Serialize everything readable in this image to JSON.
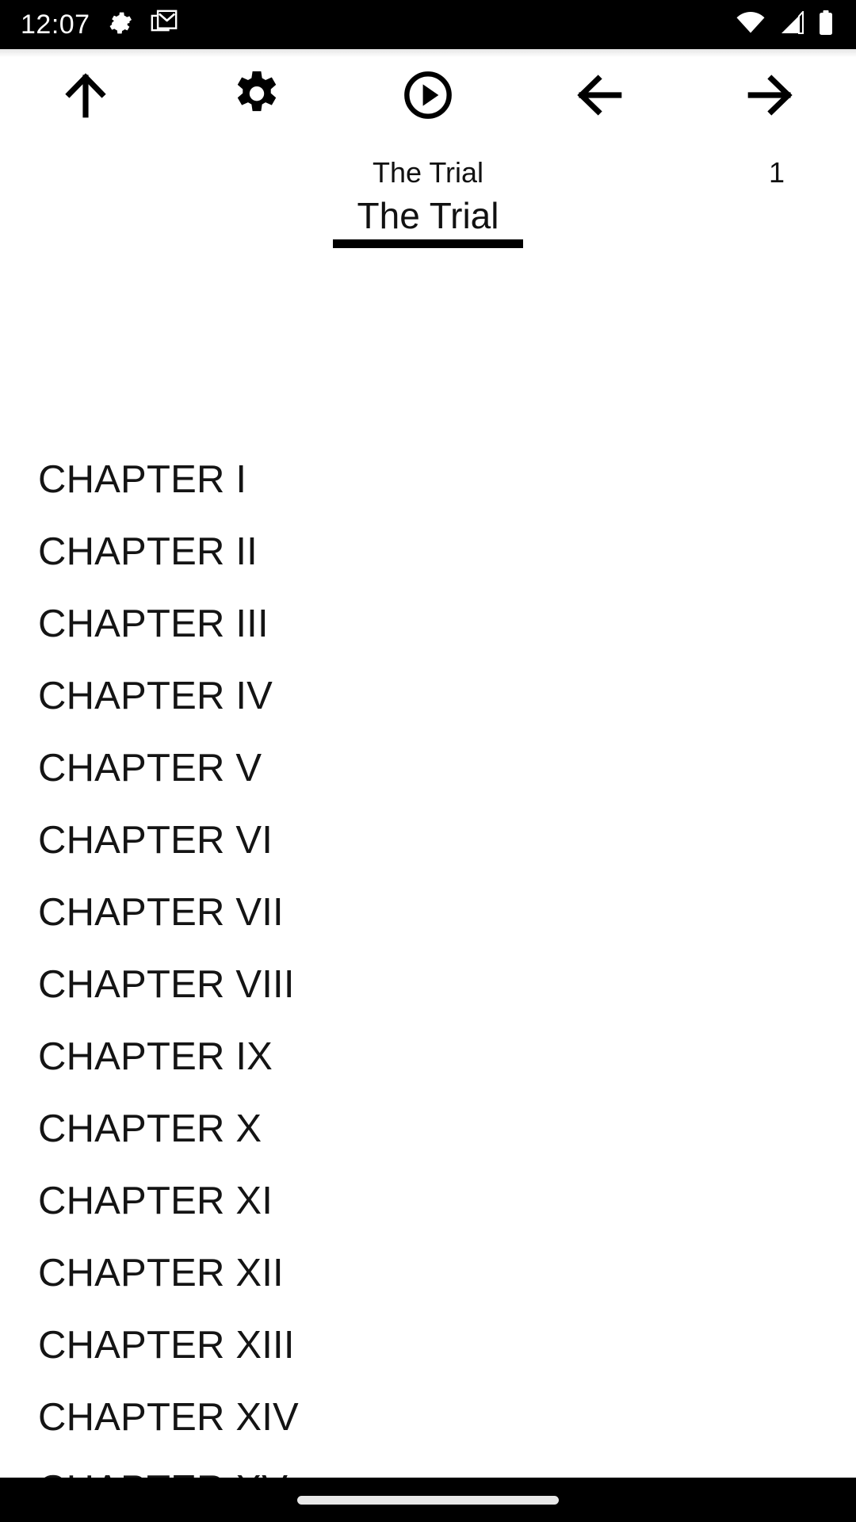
{
  "statusbar": {
    "clock": "12:07",
    "left_icons": [
      {
        "name": "settings-icon",
        "label": "settings"
      },
      {
        "name": "gmail-icon",
        "label": "gmail"
      }
    ],
    "right_icons": [
      {
        "name": "wifi-icon",
        "label": "wifi"
      },
      {
        "name": "cellular-signal-icon",
        "label": "signal"
      },
      {
        "name": "battery-icon",
        "label": "battery"
      }
    ],
    "background": "#000000",
    "foreground": "#ffffff"
  },
  "toolbar": {
    "buttons": [
      {
        "name": "go-up-button",
        "icon": "arrow-up-icon",
        "label": "Up"
      },
      {
        "name": "settings-button",
        "icon": "gear-icon",
        "label": "Settings"
      },
      {
        "name": "play-button",
        "icon": "play-circle-icon",
        "label": "Play"
      },
      {
        "name": "previous-button",
        "icon": "arrow-left-icon",
        "label": "Previous"
      },
      {
        "name": "next-button",
        "icon": "arrow-right-icon",
        "label": "Next"
      }
    ]
  },
  "header": {
    "book_title": "The Trial",
    "page_number": "1"
  },
  "tabs": {
    "selected_index": 0,
    "items": [
      {
        "label": "The Trial"
      }
    ],
    "indicator_color": "#000000"
  },
  "chapters": {
    "items": [
      {
        "label": "CHAPTER I"
      },
      {
        "label": "CHAPTER II"
      },
      {
        "label": "CHAPTER III"
      },
      {
        "label": "CHAPTER IV"
      },
      {
        "label": "CHAPTER V"
      },
      {
        "label": "CHAPTER VI"
      },
      {
        "label": "CHAPTER VII"
      },
      {
        "label": "CHAPTER VIII"
      },
      {
        "label": "CHAPTER IX"
      },
      {
        "label": "CHAPTER X"
      },
      {
        "label": "CHAPTER XI"
      },
      {
        "label": "CHAPTER XII"
      },
      {
        "label": "CHAPTER XIII"
      },
      {
        "label": "CHAPTER XIV"
      },
      {
        "label": "CHAPTER XV"
      }
    ]
  },
  "navbar": {
    "home_indicator": "home-pill",
    "background": "#000000",
    "pill_color": "#e8e8e8"
  },
  "theme": {
    "page_background": "#ffffff",
    "text_color": "#141414"
  }
}
